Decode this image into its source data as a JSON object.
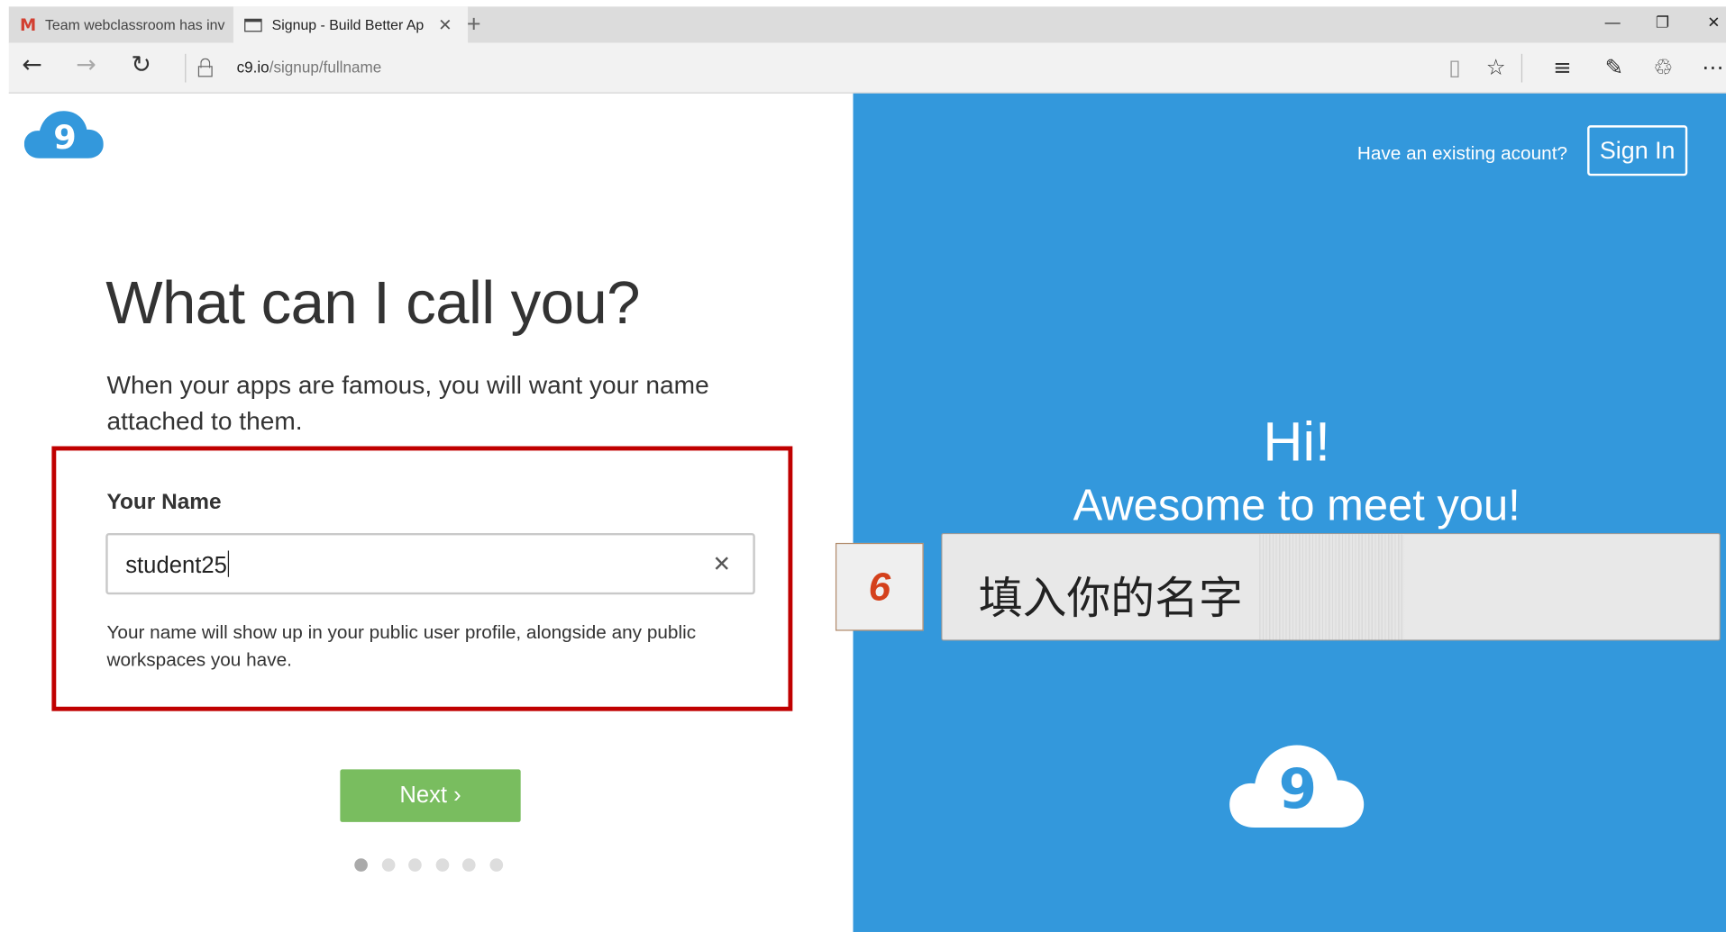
{
  "browser": {
    "tabs": [
      {
        "label": "Team webclassroom has inv",
        "icon": "gmail-icon",
        "active": false
      },
      {
        "label": "Signup - Build Better Ap",
        "icon": "page-icon",
        "active": true
      }
    ],
    "url_host": "c9.io",
    "url_path": "/signup/fullname"
  },
  "left": {
    "logo_text": "9",
    "heading": "What can I call you?",
    "subtitle": "When your apps are famous, you will want your name attached to them.",
    "field_label": "Your Name",
    "name_value": "student25",
    "help_text": "Your name will show up in your public user profile, alongside any public workspaces you have.",
    "next_label": "Next ›",
    "progress": {
      "current_step": 1,
      "total_steps": 6
    }
  },
  "right": {
    "existing_text": "Have an existing acount?",
    "signin_label": "Sign In",
    "greeting": "Hi!",
    "tagline": "Awesome to meet you!",
    "logo_text": "9"
  },
  "overlay": {
    "step_number": "6",
    "caption": "填入你的名字"
  },
  "colors": {
    "brand_blue": "#3398dc",
    "next_green": "#79bd5f",
    "highlight_red": "#c00000",
    "step_number_red": "#d4411c"
  }
}
